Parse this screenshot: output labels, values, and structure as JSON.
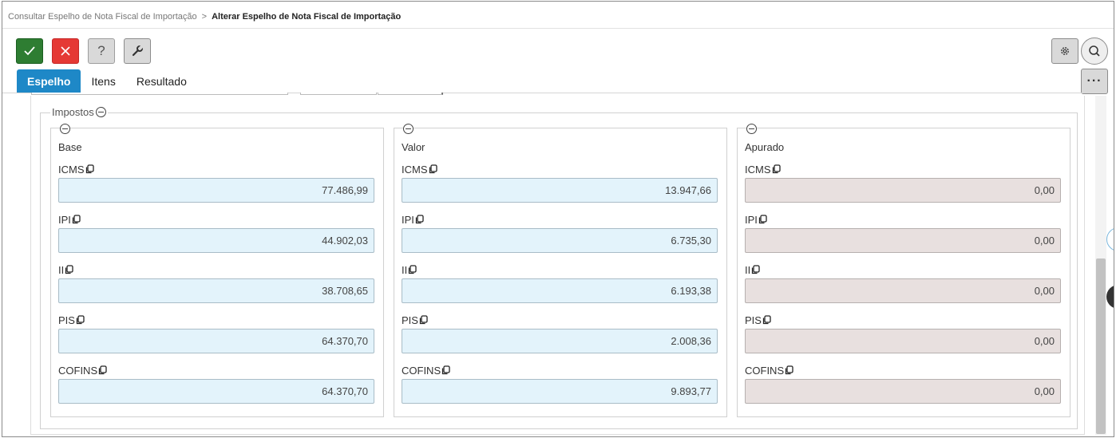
{
  "breadcrumb": {
    "parent": "Consultar Espelho de Nota Fiscal de Importação",
    "separator": ">",
    "current": "Alterar Espelho de Nota Fiscal de Importação"
  },
  "toolbar": {
    "help_label": "?"
  },
  "tabs": [
    {
      "label": "Espelho",
      "active": true
    },
    {
      "label": "Itens",
      "active": false
    },
    {
      "label": "Resultado",
      "active": false
    }
  ],
  "more_label": "···",
  "impostos": {
    "legend": "Impostos",
    "columns": [
      {
        "title": "Base",
        "style": "blue",
        "fields": [
          {
            "label": "ICMS",
            "value": "77.486,99"
          },
          {
            "label": "IPI",
            "value": "44.902,03"
          },
          {
            "label": "II",
            "value": "38.708,65"
          },
          {
            "label": "PIS",
            "value": "64.370,70"
          },
          {
            "label": "COFINS",
            "value": "64.370,70"
          }
        ]
      },
      {
        "title": "Valor",
        "style": "blue",
        "fields": [
          {
            "label": "ICMS",
            "value": "13.947,66"
          },
          {
            "label": "IPI",
            "value": "6.735,30"
          },
          {
            "label": "II",
            "value": "6.193,38"
          },
          {
            "label": "PIS",
            "value": "2.008,36"
          },
          {
            "label": "COFINS",
            "value": "9.893,77"
          }
        ]
      },
      {
        "title": "Apurado",
        "style": "gray",
        "fields": [
          {
            "label": "ICMS",
            "value": "0,00"
          },
          {
            "label": "IPI",
            "value": "0,00"
          },
          {
            "label": "II",
            "value": "0,00"
          },
          {
            "label": "PIS",
            "value": "0,00"
          },
          {
            "label": "COFINS",
            "value": "0,00"
          }
        ]
      }
    ]
  },
  "colors": {
    "ok": "#2e7d32",
    "cancel": "#e53935",
    "tab_active": "#1e88c7",
    "field_editable": "#e3f3fb",
    "field_readonly": "#e8e0df"
  }
}
